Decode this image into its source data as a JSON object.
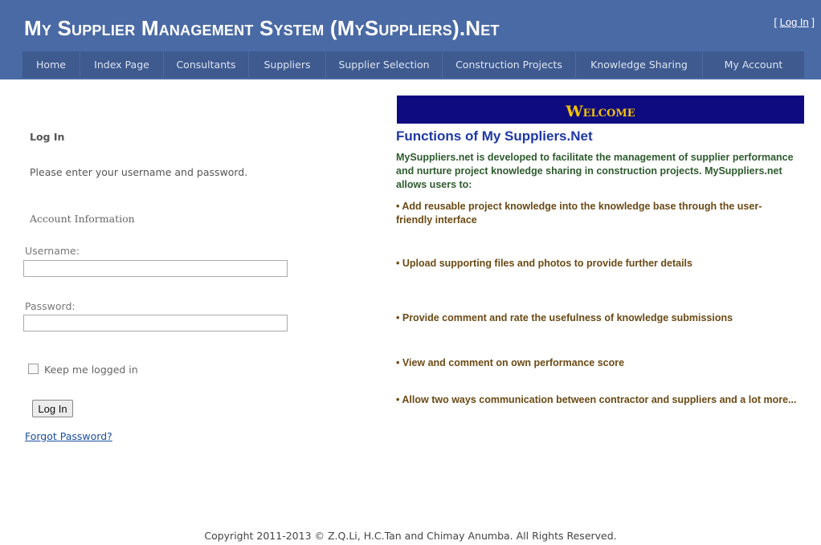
{
  "header": {
    "title": "My Supplier Management System (MySuppliers).Net",
    "login_prefix": "[ ",
    "login_link": "Log In",
    "login_suffix": " ]"
  },
  "nav": {
    "items": [
      {
        "label": "Home"
      },
      {
        "label": "Index Page"
      },
      {
        "label": "Consultants"
      },
      {
        "label": "Suppliers"
      },
      {
        "label": "Supplier Selection"
      },
      {
        "label": "Construction Projects"
      },
      {
        "label": "Knowledge Sharing"
      },
      {
        "label": "My Account"
      }
    ]
  },
  "login": {
    "heading": "Log In",
    "instructions": "Please enter your username and password.",
    "legend": "Account Information",
    "username_label": "Username:",
    "username_value": "",
    "password_label": "Password:",
    "password_value": "",
    "keep_logged_in_label": "Keep me logged in",
    "keep_logged_in_checked": false,
    "button_label": "Log In",
    "forgot_link": "Forgot Password?"
  },
  "welcome": {
    "banner": "Welcome",
    "functions_title": "Functions of My Suppliers.Net",
    "intro": "MySuppliers.net is developed to facilitate the management of supplier performance and nurture project knowledge sharing in construction projects. MySuppliers.net allows users to:",
    "bullets": [
      "Add reusable project knowledge into the knowledge base through the user-friendly interface",
      "Upload supporting files and photos to provide further details",
      "Provide comment and rate the usefulness of knowledge submissions",
      "View and comment on own performance score",
      "Allow two ways communication between contractor and suppliers and a lot more..."
    ]
  },
  "footer": {
    "copyright": "Copyright 2011-2013 © Z.Q.Li, H.C.Tan and Chimay Anumba. All Rights Reserved."
  },
  "colors": {
    "header_bg": "#4a6aa5",
    "nav_bg": "#3e5a8f",
    "welcome_bg": "#0e0a80",
    "welcome_text": "#f2c200",
    "functions_title": "#1e38a5",
    "intro_text": "#2e5b2e",
    "bullet_text": "#6b4a14"
  }
}
